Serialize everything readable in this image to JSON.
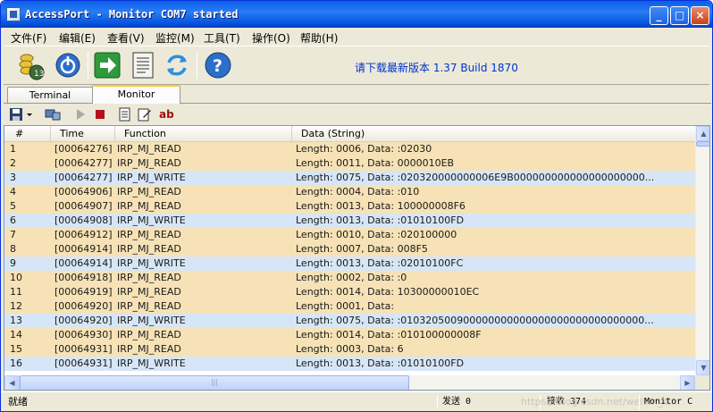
{
  "window": {
    "title": "AccessPort - Monitor COM7 started",
    "minimize": "_",
    "maximize": "□",
    "close": "×"
  },
  "menu": [
    "文件(F)",
    "编辑(E)",
    "查看(V)",
    "监控(M)",
    "工具(T)",
    "操作(O)",
    "帮助(H)"
  ],
  "toolbar": {
    "download_text": "请下载最新版本 1.37 Build 1870",
    "icons": [
      "coins-icon",
      "power-icon",
      "go-icon",
      "notepad-icon",
      "refresh-icon",
      "help-icon"
    ]
  },
  "tabs": {
    "terminal": "Terminal",
    "monitor": "Monitor"
  },
  "subtoolbar": {
    "ab_label": "ab"
  },
  "table": {
    "columns": [
      "#",
      "Time",
      "Function",
      "Data (String)"
    ],
    "rows": [
      {
        "n": "1",
        "time": "[00064276]",
        "fn": "IRP_MJ_READ",
        "data": "Length: 0006, Data: :02030",
        "kind": "read"
      },
      {
        "n": "2",
        "time": "[00064277]",
        "fn": "IRP_MJ_READ",
        "data": "Length: 0011, Data: 0000010EB",
        "kind": "read"
      },
      {
        "n": "3",
        "time": "[00064277]",
        "fn": "IRP_MJ_WRITE",
        "data": "Length: 0075, Data: :020320000000006E9B000000000000000000000...",
        "kind": "write"
      },
      {
        "n": "4",
        "time": "[00064906]",
        "fn": "IRP_MJ_READ",
        "data": "Length: 0004, Data: :010",
        "kind": "read"
      },
      {
        "n": "5",
        "time": "[00064907]",
        "fn": "IRP_MJ_READ",
        "data": "Length: 0013, Data: 100000008F6",
        "kind": "read"
      },
      {
        "n": "6",
        "time": "[00064908]",
        "fn": "IRP_MJ_WRITE",
        "data": "Length: 0013, Data: :01010100FD",
        "kind": "write"
      },
      {
        "n": "7",
        "time": "[00064912]",
        "fn": "IRP_MJ_READ",
        "data": "Length: 0010, Data: :020100000",
        "kind": "read"
      },
      {
        "n": "8",
        "time": "[00064914]",
        "fn": "IRP_MJ_READ",
        "data": "Length: 0007, Data: 008F5",
        "kind": "read"
      },
      {
        "n": "9",
        "time": "[00064914]",
        "fn": "IRP_MJ_WRITE",
        "data": "Length: 0013, Data: :02010100FC",
        "kind": "write"
      },
      {
        "n": "10",
        "time": "[00064918]",
        "fn": "IRP_MJ_READ",
        "data": "Length: 0002, Data: :0",
        "kind": "read"
      },
      {
        "n": "11",
        "time": "[00064919]",
        "fn": "IRP_MJ_READ",
        "data": "Length: 0014, Data: 10300000010EC",
        "kind": "read"
      },
      {
        "n": "12",
        "time": "[00064920]",
        "fn": "IRP_MJ_READ",
        "data": "Length: 0001, Data:",
        "kind": "read"
      },
      {
        "n": "13",
        "time": "[00064920]",
        "fn": "IRP_MJ_WRITE",
        "data": "Length: 0075, Data: :010320500900000000000000000000000000000...",
        "kind": "write"
      },
      {
        "n": "14",
        "time": "[00064930]",
        "fn": "IRP_MJ_READ",
        "data": "Length: 0014, Data: :010100000008F",
        "kind": "read"
      },
      {
        "n": "15",
        "time": "[00064931]",
        "fn": "IRP_MJ_READ",
        "data": "Length: 0003, Data: 6",
        "kind": "read"
      },
      {
        "n": "16",
        "time": "[00064931]",
        "fn": "IRP_MJ_WRITE",
        "data": "Length: 0013, Data: :01010100FD",
        "kind": "write"
      }
    ]
  },
  "status": {
    "ready": "就绪",
    "sent": "发送 0",
    "received": "接收 374",
    "watermark": "https://blog.csdn.net/weixin_4...",
    "mode": "Monitor C"
  },
  "colors": {
    "read_row": "#f6e2b6",
    "write_row": "#d6e6f6",
    "link": "#0033cc"
  }
}
